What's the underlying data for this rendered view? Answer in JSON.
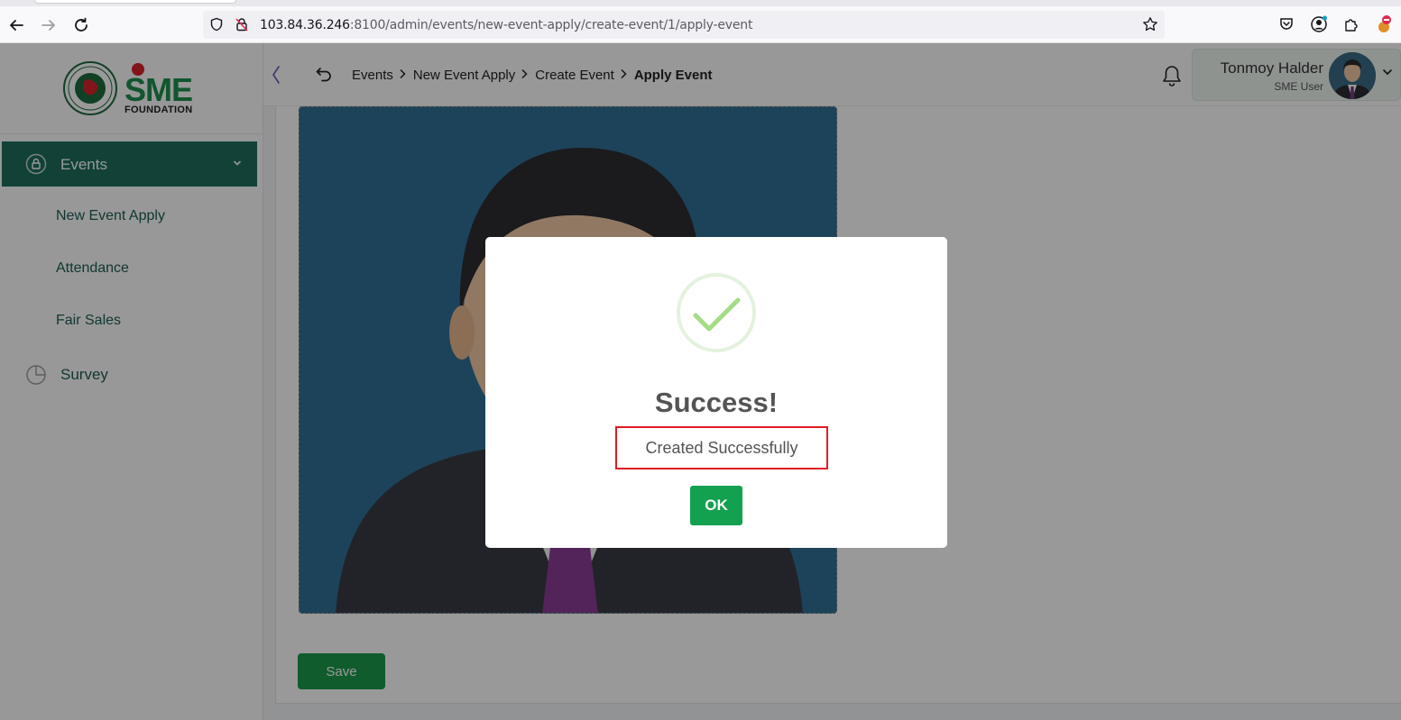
{
  "browser": {
    "url_host": "103.84.36.246",
    "url_rest": ":8100/admin/events/new-event-apply/create-event/1/apply-event"
  },
  "logo": {
    "brand": "SME",
    "tagline": "FOUNDATION"
  },
  "sidebar": {
    "active_item": "Events",
    "sub_items": [
      {
        "label": "New Event Apply"
      },
      {
        "label": "Attendance"
      },
      {
        "label": "Fair Sales"
      }
    ],
    "items": [
      {
        "label": "Survey"
      }
    ]
  },
  "breadcrumb": [
    {
      "label": "Events"
    },
    {
      "label": "New Event Apply"
    },
    {
      "label": "Create Event"
    },
    {
      "label": "Apply Event"
    }
  ],
  "user": {
    "name": "Tonmoy Halder",
    "role": "SME User"
  },
  "form": {
    "save_label": "Save"
  },
  "modal": {
    "title": "Success!",
    "message": "Created Successfully",
    "ok_label": "OK"
  },
  "colors": {
    "primary": "#1f6f5c",
    "success_button": "#13a150",
    "highlight_box": "#e01b24",
    "check": "#a5dc86"
  }
}
